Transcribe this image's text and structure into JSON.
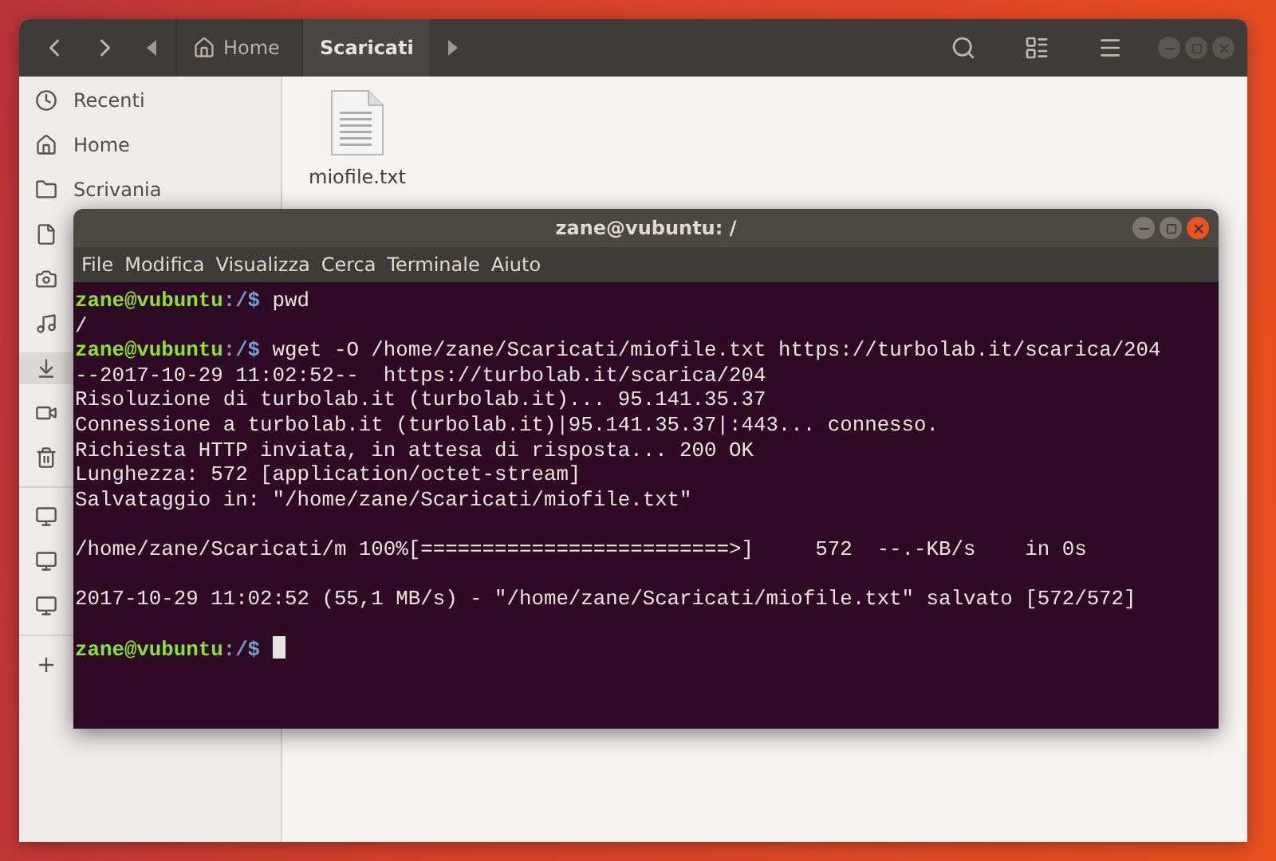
{
  "files_window": {
    "focused": false,
    "breadcrumbs": [
      {
        "label": "Home",
        "selected": false
      },
      {
        "label": "Scaricati",
        "selected": true
      }
    ],
    "sidebar": {
      "sections": [
        [
          {
            "label": "Recenti",
            "selected": false
          },
          {
            "label": "Home",
            "selected": false
          },
          {
            "label": "Scrivania",
            "selected": false
          },
          {
            "selected": false
          },
          {
            "selected": false
          },
          {
            "selected": false
          },
          {
            "selected": true
          },
          {
            "selected": false
          },
          {
            "selected": false
          }
        ],
        [
          {
            "selected": false
          },
          {
            "selected": false
          },
          {
            "selected": false
          }
        ],
        [
          {
            "selected": false
          }
        ]
      ]
    },
    "files": [
      {
        "name": "miofile.txt"
      }
    ]
  },
  "terminal": {
    "title": "zane@vubuntu: /",
    "focused": true,
    "menu": [
      "File",
      "Modifica",
      "Visualizza",
      "Cerca",
      "Terminale",
      "Aiuto"
    ],
    "lines": [
      {
        "kind": "prompt",
        "user": "zane@vubuntu",
        "path": ":/$",
        "command": "pwd"
      },
      {
        "kind": "output",
        "text": "/"
      },
      {
        "kind": "prompt",
        "user": "zane@vubuntu",
        "path": ":/$",
        "command": "wget -O /home/zane/Scaricati/miofile.txt https://turbolab.it/scarica/204"
      },
      {
        "kind": "output",
        "text": "--2017-10-29 11:02:52--  https://turbolab.it/scarica/204"
      },
      {
        "kind": "output",
        "text": "Risoluzione di turbolab.it (turbolab.it)... 95.141.35.37"
      },
      {
        "kind": "output",
        "text": "Connessione a turbolab.it (turbolab.it)|95.141.35.37|:443... connesso."
      },
      {
        "kind": "output",
        "text": "Richiesta HTTP inviata, in attesa di risposta... 200 OK"
      },
      {
        "kind": "output",
        "text": "Lunghezza: 572 [application/octet-stream]"
      },
      {
        "kind": "output",
        "text": "Salvataggio in: \"/home/zane/Scaricati/miofile.txt\""
      },
      {
        "kind": "blank"
      },
      {
        "kind": "output",
        "text": "/home/zane/Scaricati/m 100%[=========================>]     572  --.-KB/s    in 0s"
      },
      {
        "kind": "blank"
      },
      {
        "kind": "output",
        "text": "2017-10-29 11:02:52 (55,1 MB/s) - \"/home/zane/Scaricati/miofile.txt\" salvato [572/572]"
      },
      {
        "kind": "blank"
      },
      {
        "kind": "prompt",
        "user": "zane@vubuntu",
        "path": ":/$",
        "cursor": true
      }
    ]
  }
}
